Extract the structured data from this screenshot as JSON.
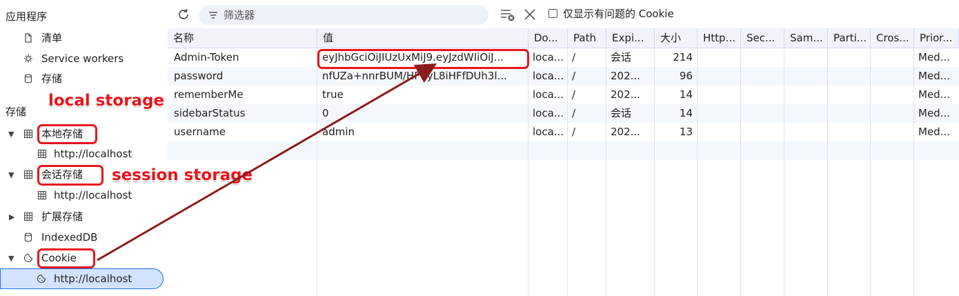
{
  "sidebar": {
    "app_heading": "应用程序",
    "app_items": [
      {
        "label": "清单",
        "icon": "document-icon"
      },
      {
        "label": "Service workers",
        "icon": "service-worker-icon"
      },
      {
        "label": "存储",
        "icon": "database-icon"
      }
    ],
    "storage_heading": "存储",
    "storage_items": [
      {
        "label": "本地存储",
        "icon": "grid-icon",
        "expanded": true,
        "child": "http://localhost"
      },
      {
        "label": "会话存储",
        "icon": "grid-icon",
        "expanded": true,
        "child": "http://localhost"
      },
      {
        "label": "扩展存储",
        "icon": "grid-icon",
        "expanded": false
      },
      {
        "label": "IndexedDB",
        "icon": "database-icon"
      },
      {
        "label": "Cookie",
        "icon": "cookie-icon",
        "expanded": true,
        "child": "http://localhost"
      }
    ]
  },
  "toolbar": {
    "filter_placeholder": "筛选器",
    "only_issues_label": "仅显示有问题的 Cookie"
  },
  "table": {
    "columns": [
      "名称",
      "值",
      "Do...",
      "Path",
      "Expi...",
      "大小",
      "Http...",
      "Sec...",
      "Sam...",
      "Parti...",
      "Cros...",
      "Prior..."
    ],
    "rows": [
      [
        "Admin-Token",
        "eyJhbGciOiJIUzUxMiJ9.eyJzdWIiOiJ...",
        "loca...",
        "/",
        "会话",
        "214",
        "",
        "",
        "",
        "",
        "",
        "Med..."
      ],
      [
        "password",
        "nfUZa+nnrBUM/HFVyL8iHFfDUh3l...",
        "loca...",
        "/",
        "202...",
        "96",
        "",
        "",
        "",
        "",
        "",
        "Med..."
      ],
      [
        "rememberMe",
        "true",
        "loca...",
        "/",
        "202...",
        "14",
        "",
        "",
        "",
        "",
        "",
        "Med..."
      ],
      [
        "sidebarStatus",
        "0",
        "loca...",
        "/",
        "会话",
        "14",
        "",
        "",
        "",
        "",
        "",
        "Med..."
      ],
      [
        "username",
        "admin",
        "loca...",
        "/",
        "202...",
        "13",
        "",
        "",
        "",
        "",
        "",
        "Med..."
      ]
    ]
  },
  "annotations": {
    "local": "local storage",
    "session": "session storage"
  },
  "colors": {
    "annotation_red": "#e8141c",
    "arrow": "#8b1a1a",
    "selection_bg": "#d3e3fd",
    "header_bg": "#f1f3f9"
  }
}
